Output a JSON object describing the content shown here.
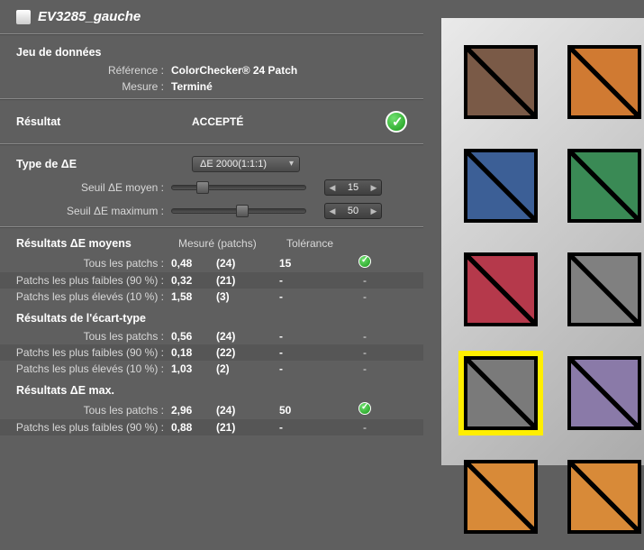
{
  "title": "EV3285_gauche",
  "sections": {
    "dataset_label": "Jeu de données",
    "reference_label": "Référence :",
    "reference_value": "ColorChecker® 24 Patch",
    "measure_label": "Mesure :",
    "measure_value": "Terminé"
  },
  "result": {
    "label": "Résultat",
    "value": "ACCEPTÉ"
  },
  "delta_e": {
    "label": "Type de ΔE",
    "select_value": "ΔE 2000(1:1:1)",
    "avg_threshold_label": "Seuil ΔE moyen :",
    "avg_threshold_value": "15",
    "max_threshold_label": "Seuil ΔE maximum :",
    "max_threshold_value": "50"
  },
  "columns": {
    "measured": "Mesuré (patchs)",
    "tolerance": "Tolérance"
  },
  "avg_section": "Résultats ΔE moyens",
  "std_section": "Résultats de l'écart-type",
  "max_section": "Résultats ΔE max.",
  "row_labels": {
    "all": "Tous les patchs :",
    "low90": "Patchs les plus faibles (90 %) :",
    "high10": "Patchs les plus élevés (10 %) :"
  },
  "avg_rows": [
    {
      "meas": "0,48",
      "count": "(24)",
      "tol": "15",
      "ok": true
    },
    {
      "meas": "0,32",
      "count": "(21)",
      "tol": "-",
      "ok": false
    },
    {
      "meas": "1,58",
      "count": "(3)",
      "tol": "-",
      "ok": false
    }
  ],
  "std_rows": [
    {
      "meas": "0,56",
      "count": "(24)",
      "tol": "-",
      "ok": false
    },
    {
      "meas": "0,18",
      "count": "(22)",
      "tol": "-",
      "ok": false
    },
    {
      "meas": "1,03",
      "count": "(2)",
      "tol": "-",
      "ok": false
    }
  ],
  "max_rows": [
    {
      "meas": "2,96",
      "count": "(24)",
      "tol": "50",
      "ok": true
    },
    {
      "meas": "0,88",
      "count": "(21)",
      "tol": "-",
      "ok": false
    }
  ],
  "swatches": [
    {
      "fill": "#7a5a47",
      "selected": false
    },
    {
      "fill": "#d07a32",
      "selected": false
    },
    {
      "fill": "#3c5f96",
      "selected": false
    },
    {
      "fill": "#3a8a55",
      "selected": false
    },
    {
      "fill": "#b5394b",
      "selected": false
    },
    {
      "fill": "#808080",
      "selected": false
    },
    {
      "fill": "#7a7a7a",
      "selected": true
    },
    {
      "fill": "#8a7aa8",
      "selected": false
    },
    {
      "fill": "#d88a38",
      "selected": false
    },
    {
      "fill": "#d88a38",
      "selected": false
    }
  ]
}
